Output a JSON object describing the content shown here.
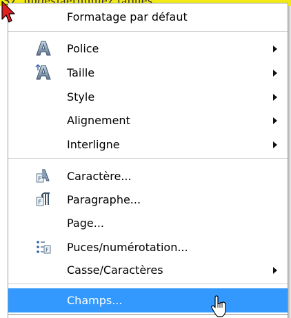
{
  "document": {
    "partial_text": "Sz, undesiaerunmez tabnes"
  },
  "menu": {
    "items": [
      {
        "label": "Formatage par défaut"
      },
      {
        "label": "Police",
        "icon": "font-a-icon"
      },
      {
        "label": "Taille",
        "icon": "font-size-a-icon"
      },
      {
        "label": "Style"
      },
      {
        "label": "Alignement"
      },
      {
        "label": "Interligne"
      },
      {
        "label": "Caractère...",
        "icon": "character-icon"
      },
      {
        "label": "Paragraphe...",
        "icon": "paragraph-icon"
      },
      {
        "label": "Page..."
      },
      {
        "label": "Puces/numérotation...",
        "icon": "bullets-numbering-icon"
      },
      {
        "label": "Casse/Caractères"
      },
      {
        "label": "Champs...",
        "highlighted": true
      }
    ]
  },
  "colors": {
    "highlight": "#3399ff",
    "document_background": "#f2ea14",
    "menu_background": "#ffffff"
  }
}
